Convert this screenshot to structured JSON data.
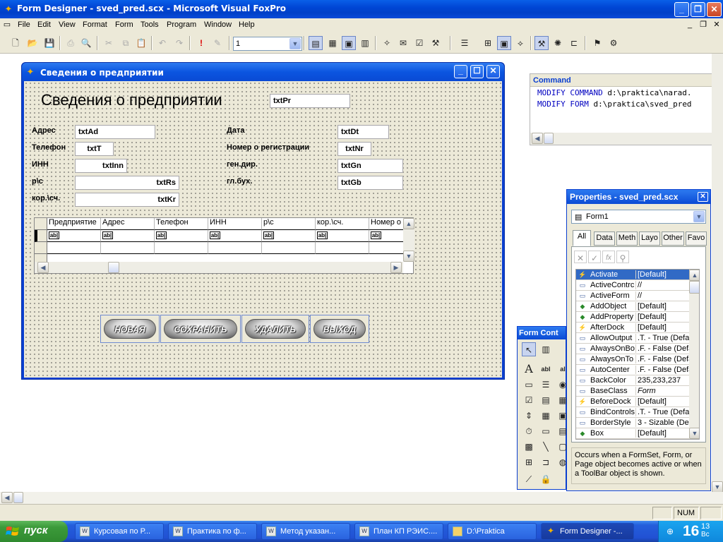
{
  "window": {
    "title": "Form Designer - sved_pred.scx - Microsoft Visual FoxPro"
  },
  "menu": [
    "File",
    "Edit",
    "View",
    "Format",
    "Form",
    "Tools",
    "Program",
    "Window",
    "Help"
  ],
  "toolbar": {
    "combo_value": "1"
  },
  "form": {
    "title": "Сведения о предприятии",
    "heading": "Сведения  о предприятии",
    "heading_box": "txtPr",
    "left_fields": [
      {
        "label": "Адрес",
        "value": "txtAd"
      },
      {
        "label": "Телефон",
        "value": "txtT"
      },
      {
        "label": "ИНН",
        "value": "txtInn"
      },
      {
        "label": "р\\с",
        "value": "txtRs"
      },
      {
        "label": "кор.\\сч.",
        "value": "txtKr"
      }
    ],
    "right_fields": [
      {
        "label": "Дата",
        "value": "txtDt"
      },
      {
        "label": "Номер о регистрации",
        "value": "txtNr"
      },
      {
        "label": "ген.дир.",
        "value": "txtGn"
      },
      {
        "label": "гл.бух.",
        "value": "txtGb"
      }
    ],
    "grid_columns": [
      "Предприятие",
      "Адрес",
      "Телефон",
      "ИНН",
      "р\\с",
      "кор.\\сч.",
      "Номер о"
    ],
    "grid_cell_icon": "ab|",
    "buttons": [
      "НОВАЯ",
      "СОХРАНИТЬ",
      "УДАЛИТЬ",
      "ВЫХОД"
    ]
  },
  "command": {
    "title": "Command",
    "lines": [
      {
        "kw": "MODIFY COMMAND",
        "arg": "d:\\praktica\\narad."
      },
      {
        "kw": "MODIFY FORM",
        "arg": "d:\\praktica\\sved_pred"
      }
    ]
  },
  "properties": {
    "title": "Properties - sved_pred.scx",
    "object": "Form1",
    "tabs": [
      "All",
      "Data",
      "Meth",
      "Layo",
      "Other",
      "Favo"
    ],
    "rows": [
      {
        "name": "Activate",
        "value": "[Default]",
        "icon": "event-icon"
      },
      {
        "name": "ActiveContrc",
        "value": "//",
        "icon": "property-icon"
      },
      {
        "name": "ActiveForm",
        "value": "//",
        "icon": "property-icon"
      },
      {
        "name": "AddObject",
        "value": "[Default]",
        "icon": "method-icon"
      },
      {
        "name": "AddProperty",
        "value": "[Default]",
        "icon": "method-icon"
      },
      {
        "name": "AfterDock",
        "value": "[Default]",
        "icon": "event-icon"
      },
      {
        "name": "AllowOutput",
        "value": ".T. - True (Defau",
        "icon": "property-icon"
      },
      {
        "name": "AlwaysOnBo",
        "value": ".F. - False (Defa",
        "icon": "property-icon"
      },
      {
        "name": "AlwaysOnTo",
        "value": ".F. - False (Defa",
        "icon": "property-icon"
      },
      {
        "name": "AutoCenter",
        "value": ".F. - False (Defa",
        "icon": "property-icon"
      },
      {
        "name": "BackColor",
        "value": "235,233,237",
        "icon": "property-icon"
      },
      {
        "name": "BaseClass",
        "value": "Form",
        "icon": "property-icon"
      },
      {
        "name": "BeforeDock",
        "value": "[Default]",
        "icon": "event-icon"
      },
      {
        "name": "BindControls",
        "value": ".T. - True (Defa",
        "icon": "property-icon"
      },
      {
        "name": "BorderStyle",
        "value": "3 - Sizable (Defa",
        "icon": "property-icon"
      },
      {
        "name": "Box",
        "value": "[Default]",
        "icon": "method-icon"
      }
    ],
    "description": "Occurs when a FormSet, Form, or Page object becomes active or when a ToolBar object is shown."
  },
  "form_controls": {
    "title": "Form Cont"
  },
  "status": {
    "num": "NUM"
  },
  "taskbar": {
    "start": "пуск",
    "tasks": [
      "Курсовая по Р...",
      "Практика по ф...",
      "Метод указан...",
      "План КП РЭИС....",
      "D:\\Praktica",
      "Form Designer -..."
    ],
    "clock": "16",
    "clock_small": "13",
    "clock_day": "Вс"
  }
}
